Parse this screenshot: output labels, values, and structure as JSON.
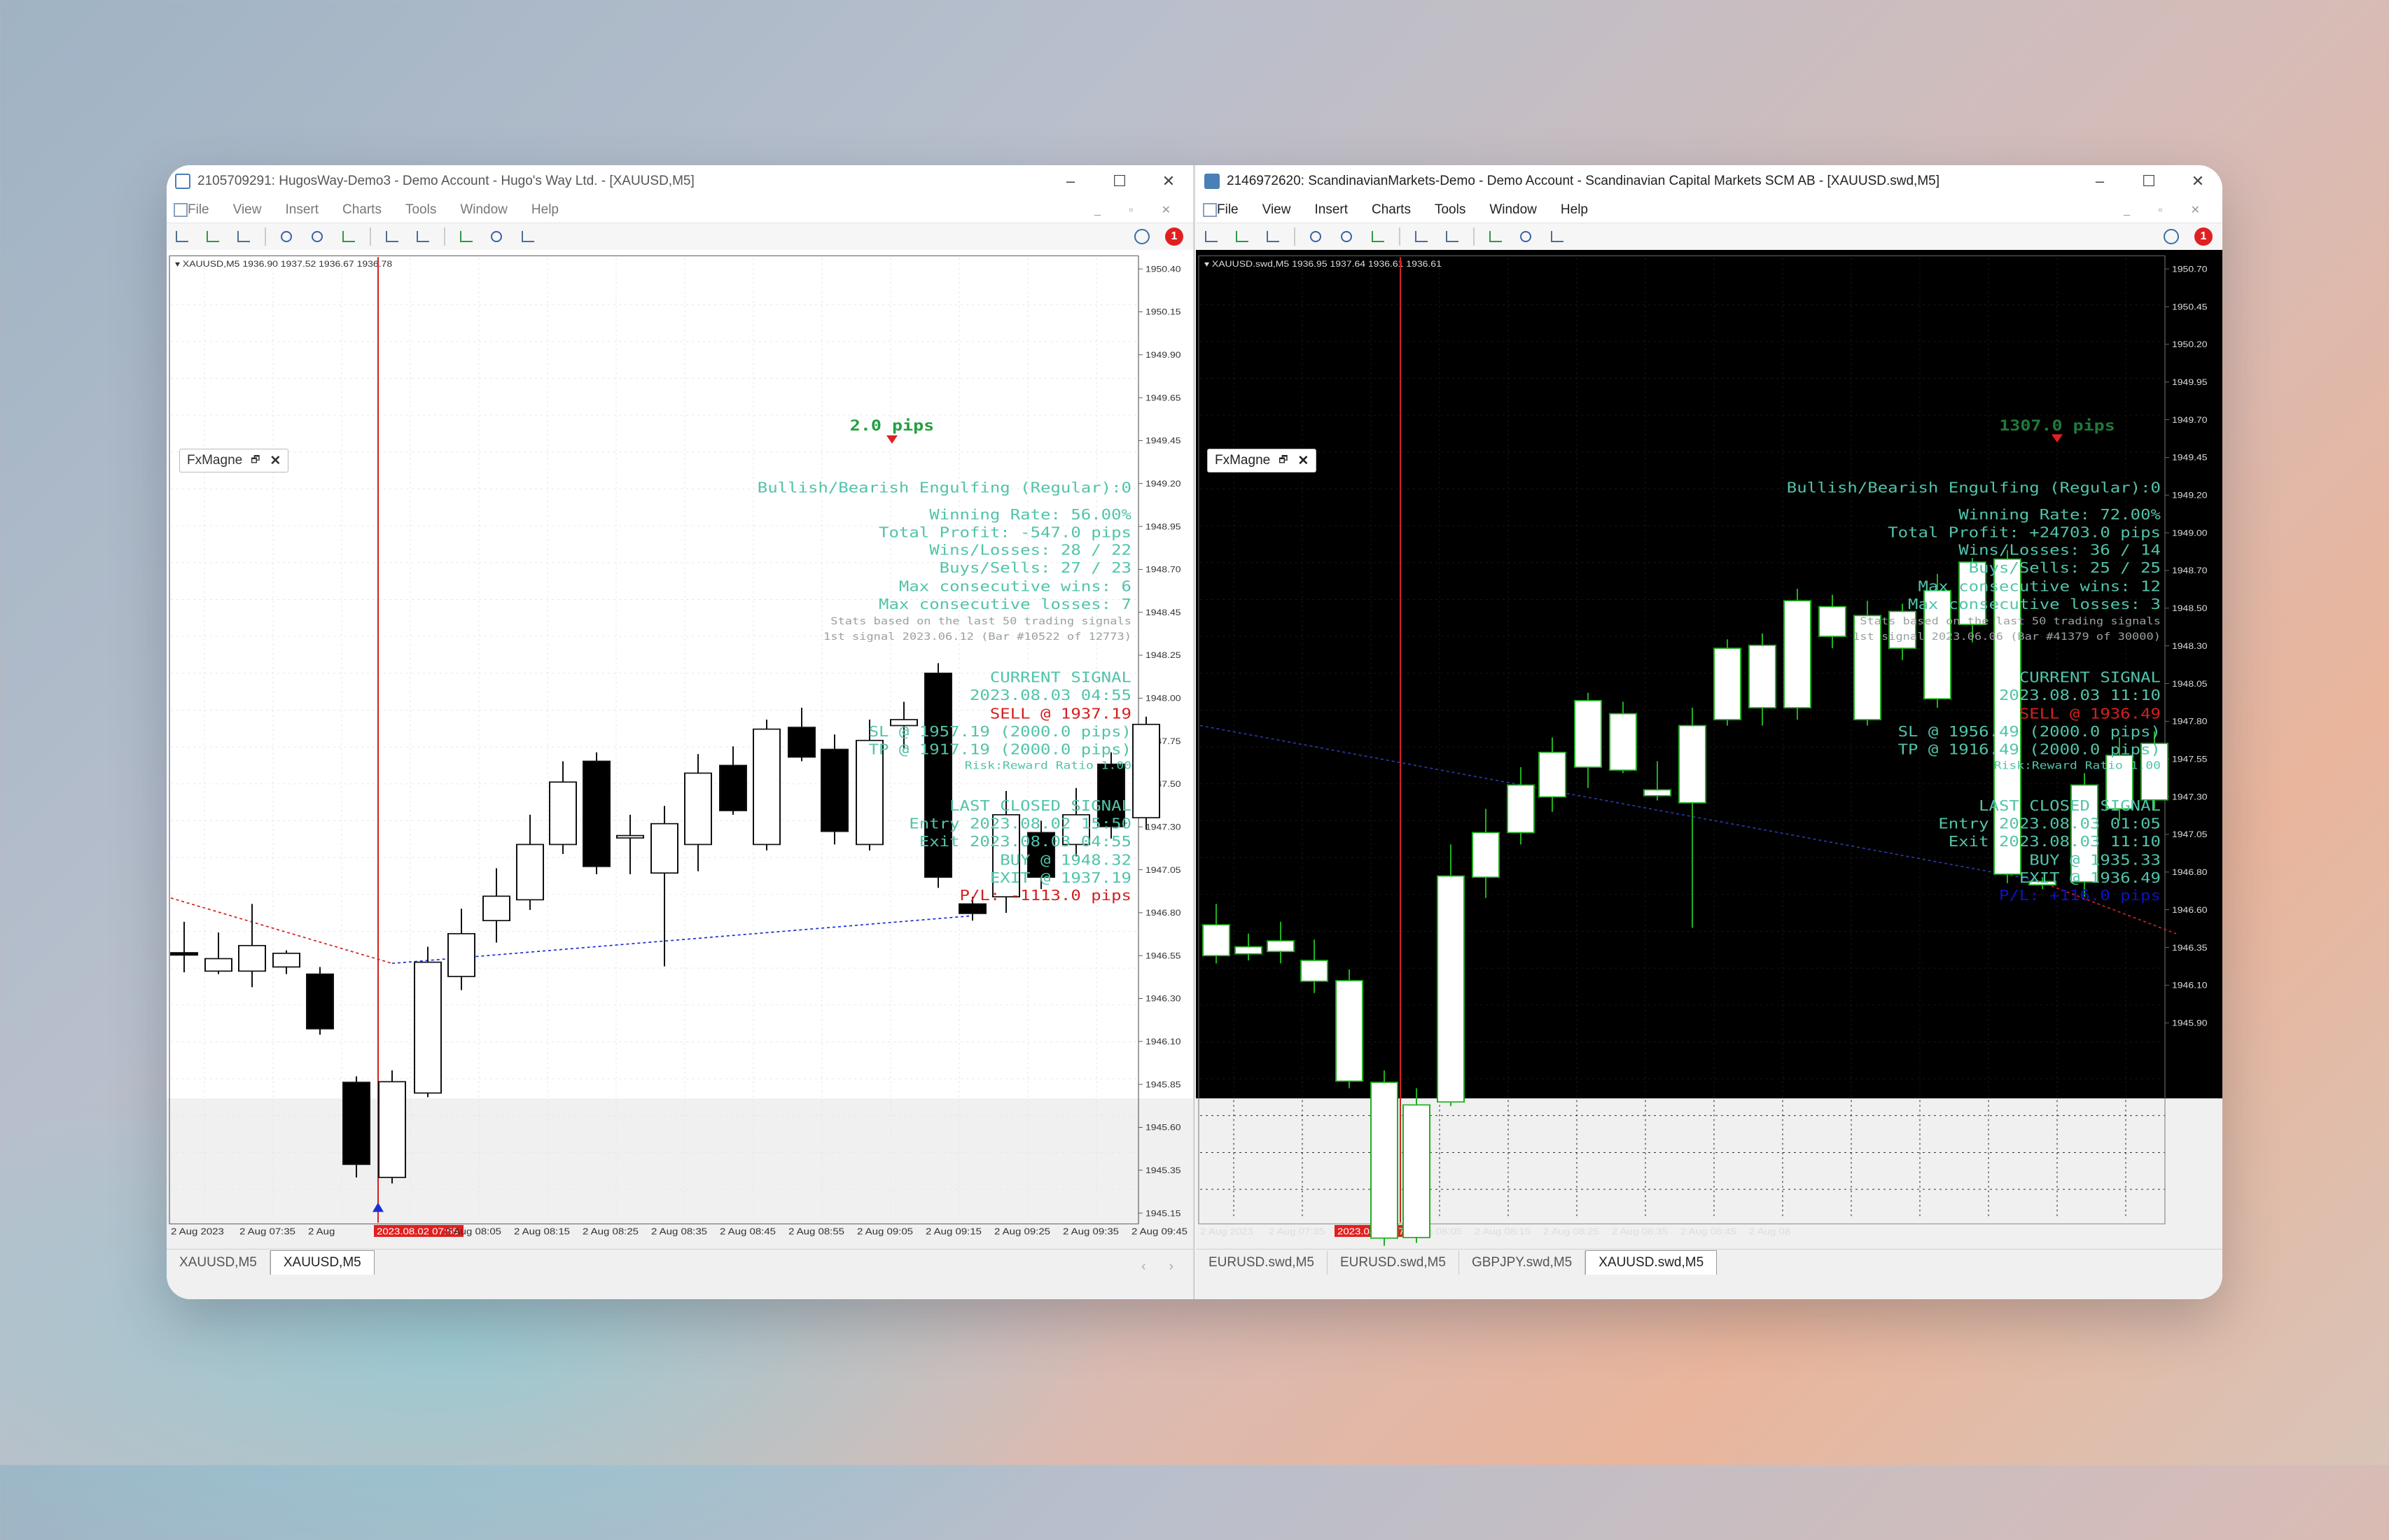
{
  "colors": {
    "accent_teal": "#52c3aa",
    "sell_red": "#d42020",
    "buy_green": "#22a040",
    "pl_blue": "#1010c8"
  },
  "left": {
    "title": "2105709291: HugosWay-Demo3 - Demo Account - Hugo's Way Ltd. - [XAUUSD,M5]",
    "menu": [
      "File",
      "View",
      "Insert",
      "Charts",
      "Tools",
      "Window",
      "Help"
    ],
    "symbol_info": "XAUUSD,M5  1936.90 1937.52 1936.67 1936.78",
    "badge": "FxMagne",
    "pips_label": "2.0 pips",
    "notif_count": "1",
    "stats": {
      "pattern": "Bullish/Bearish Engulfing (Regular):0",
      "winning_rate": "Winning Rate: 56.00%",
      "total_profit": "Total Profit: -547.0 pips",
      "wins_losses": "Wins/Losses: 28 / 22",
      "buys_sells": "Buys/Sells: 27 / 23",
      "max_wins": "Max consecutive wins: 6",
      "max_losses": "Max consecutive losses: 7",
      "based_on": "Stats based on the last 50 trading signals",
      "first_signal": "1st signal 2023.06.12 (Bar #10522 of 12773)"
    },
    "current": {
      "heading": "CURRENT SIGNAL",
      "time": "2023.08.03 04:55",
      "action": "SELL @ 1937.19",
      "sl": "SL @ 1957.19 (2000.0 pips)",
      "tp": "TP @ 1917.19 (2000.0 pips)",
      "rr": "Risk:Reward Ratio 1.00"
    },
    "last": {
      "heading": "LAST CLOSED SIGNAL",
      "entry": "Entry 2023.08.02 15:50",
      "exit_time": "Exit 2023.08.03 04:55",
      "buy": "BUY @ 1948.32",
      "exit_price": "EXIT @ 1937.19",
      "pl": "P/L: -1113.0 pips"
    },
    "price_axis": [
      "1950.40",
      "1950.15",
      "1949.90",
      "1949.65",
      "1949.45",
      "1949.20",
      "1948.95",
      "1948.70",
      "1948.45",
      "1948.25",
      "1948.00",
      "1947.75",
      "1947.50",
      "1947.30",
      "1947.05",
      "1946.80",
      "1946.55",
      "1946.30",
      "1946.10",
      "1945.85",
      "1945.60",
      "1945.35",
      "1945.15"
    ],
    "time_axis": [
      "2 Aug 2023",
      "2 Aug 07:35",
      "2 Aug",
      "2023.08.02 07:55",
      "2 Aug 08:05",
      "2 Aug 08:15",
      "2 Aug 08:25",
      "2 Aug 08:35",
      "2 Aug 08:45",
      "2 Aug 08:55",
      "2 Aug 09:05",
      "2 Aug 09:15",
      "2 Aug 09:25",
      "2 Aug 09:35",
      "2 Aug 09:45"
    ],
    "tabs": [
      "XAUUSD,M5",
      "XAUUSD,M5"
    ],
    "active_tab": 1
  },
  "right": {
    "title": "2146972620: ScandinavianMarkets-Demo - Demo Account - Scandinavian Capital Markets SCM AB - [XAUUSD.swd,M5]",
    "menu": [
      "File",
      "View",
      "Insert",
      "Charts",
      "Tools",
      "Window",
      "Help"
    ],
    "symbol_info": "XAUUSD.swd,M5  1936.95 1937.64 1936.61 1936.61",
    "badge": "FxMagne",
    "pips_label": "1307.0 pips",
    "notif_count": "1",
    "stats": {
      "pattern": "Bullish/Bearish Engulfing (Regular):0",
      "winning_rate": "Winning Rate: 72.00%",
      "total_profit": "Total Profit: +24703.0 pips",
      "wins_losses": "Wins/Losses: 36 / 14",
      "buys_sells": "Buys/Sells: 25 / 25",
      "max_wins": "Max consecutive wins: 12",
      "max_losses": "Max consecutive losses: 3",
      "based_on": "Stats based on the last 50 trading signals",
      "first_signal": "1st signal 2023.06.06 (Bar #41379 of 30000)"
    },
    "current": {
      "heading": "CURRENT SIGNAL",
      "time": "2023.08.03 11:10",
      "action": "SELL @ 1936.49",
      "sl": "SL @ 1956.49 (2000.0 pips)",
      "tp": "TP @ 1916.49 (2000.0 pips)",
      "rr": "Risk:Reward Ratio 1.00"
    },
    "last": {
      "heading": "LAST CLOSED SIGNAL",
      "entry": "Entry 2023.08.03 01:05",
      "exit_time": "Exit 2023.08.03 11:10",
      "buy": "BUY @ 1935.33",
      "exit_price": "EXIT @ 1936.49",
      "pl": "P/L: +116.0 pips"
    },
    "price_axis": [
      "1950.70",
      "1950.45",
      "1950.20",
      "1949.95",
      "1949.70",
      "1949.45",
      "1949.20",
      "1949.00",
      "1948.70",
      "1948.50",
      "1948.30",
      "1948.05",
      "1947.80",
      "1947.55",
      "1947.30",
      "1947.05",
      "1946.80",
      "1946.60",
      "1946.35",
      "1946.10",
      "1945.90"
    ],
    "time_axis": [
      "2 Aug 2023",
      "2 Aug 07:35",
      "2023.08.02 07:55",
      "2 Aug 08:05",
      "2 Aug 08:15",
      "2 Aug 08:25",
      "2 Aug 08:35",
      "2 Aug 08:45",
      "2 Aug 08"
    ],
    "tabs": [
      "EURUSD.swd,M5",
      "EURUSD.swd,M5",
      "GBPJPY.swd,M5",
      "XAUUSD.swd,M5"
    ],
    "active_tab": 3
  }
}
